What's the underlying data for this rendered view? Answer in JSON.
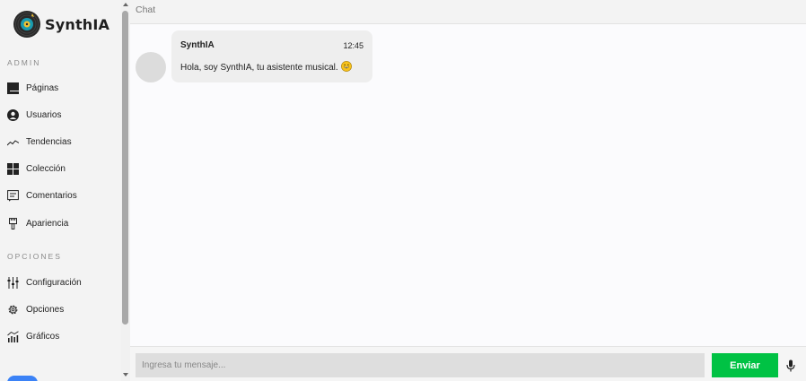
{
  "brand": {
    "name": "SynthIA",
    "accent": "#1a9bb0"
  },
  "sidebar": {
    "admin_title": "ADMIN",
    "admin_items": [
      {
        "label": "Páginas",
        "icon": "pages-icon"
      },
      {
        "label": "Usuarios",
        "icon": "user-icon"
      },
      {
        "label": "Tendencias",
        "icon": "trend-icon"
      },
      {
        "label": "Colección",
        "icon": "grid-icon"
      },
      {
        "label": "Comentarios",
        "icon": "comment-icon"
      },
      {
        "label": "Apariencia",
        "icon": "brush-icon"
      }
    ],
    "options_title": "OPCIONES",
    "options_items": [
      {
        "label": "Configuración",
        "icon": "sliders-icon"
      },
      {
        "label": "Opciones",
        "icon": "gear-icon"
      },
      {
        "label": "Gráficos",
        "icon": "chart-icon"
      }
    ]
  },
  "chat": {
    "header": "Chat",
    "messages": [
      {
        "sender": "SynthIA",
        "time": "12:45",
        "text": "Hola, soy SynthIA, tu asistente musical.",
        "emoji": "grinning-face-icon"
      }
    ],
    "input_placeholder": "Ingresa tu mensaje...",
    "send_label": "Enviar",
    "send_color": "#00c244"
  }
}
